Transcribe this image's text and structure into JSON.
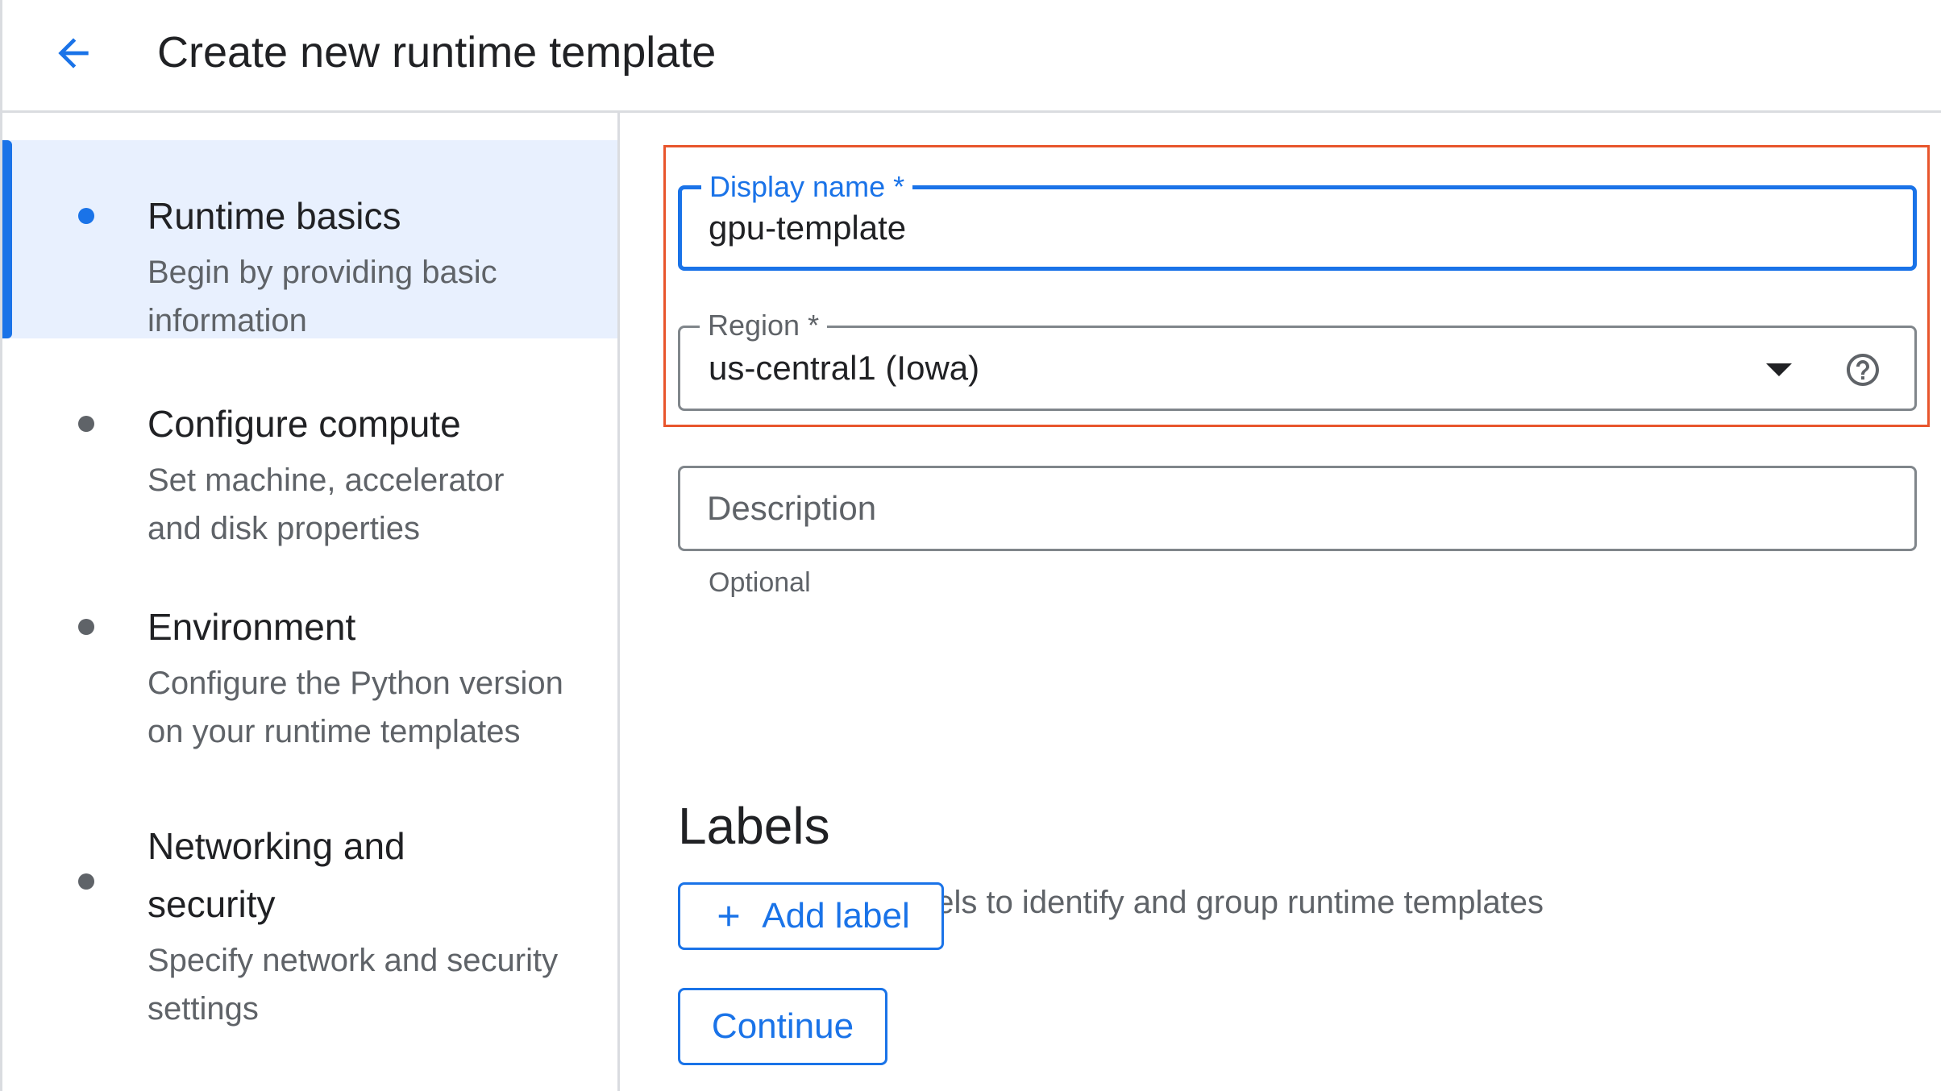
{
  "header": {
    "title": "Create new runtime template"
  },
  "steps": [
    {
      "title": "Runtime basics",
      "description": "Begin by providing basic information",
      "active": true
    },
    {
      "title": "Configure compute",
      "description": "Set machine, accelerator and disk properties",
      "active": false
    },
    {
      "title": "Environment",
      "description": "Configure the Python version on your runtime templates",
      "active": false
    },
    {
      "title": "Networking and security",
      "description": "Specify network and security settings",
      "active": false
    }
  ],
  "form": {
    "display_name": {
      "label": "Display name *",
      "value": "gpu-template"
    },
    "region": {
      "label": "Region *",
      "value": "us-central1 (Iowa)"
    },
    "description": {
      "placeholder": "Description",
      "helper": "Optional"
    }
  },
  "labels_section": {
    "title": "Labels",
    "description": "Optionally add labels to identify and group runtime templates",
    "add_button": "Add label"
  },
  "actions": {
    "continue_button": "Continue"
  },
  "colors": {
    "accent": "#1a73e8",
    "active_step_bg": "#e8f0fe",
    "highlight_border": "#e8552c",
    "text_primary": "#202124",
    "text_secondary": "#5f6368"
  },
  "icons": [
    "arrow-back-icon",
    "dropdown-arrow-icon",
    "help-circle-icon",
    "plus-icon"
  ]
}
